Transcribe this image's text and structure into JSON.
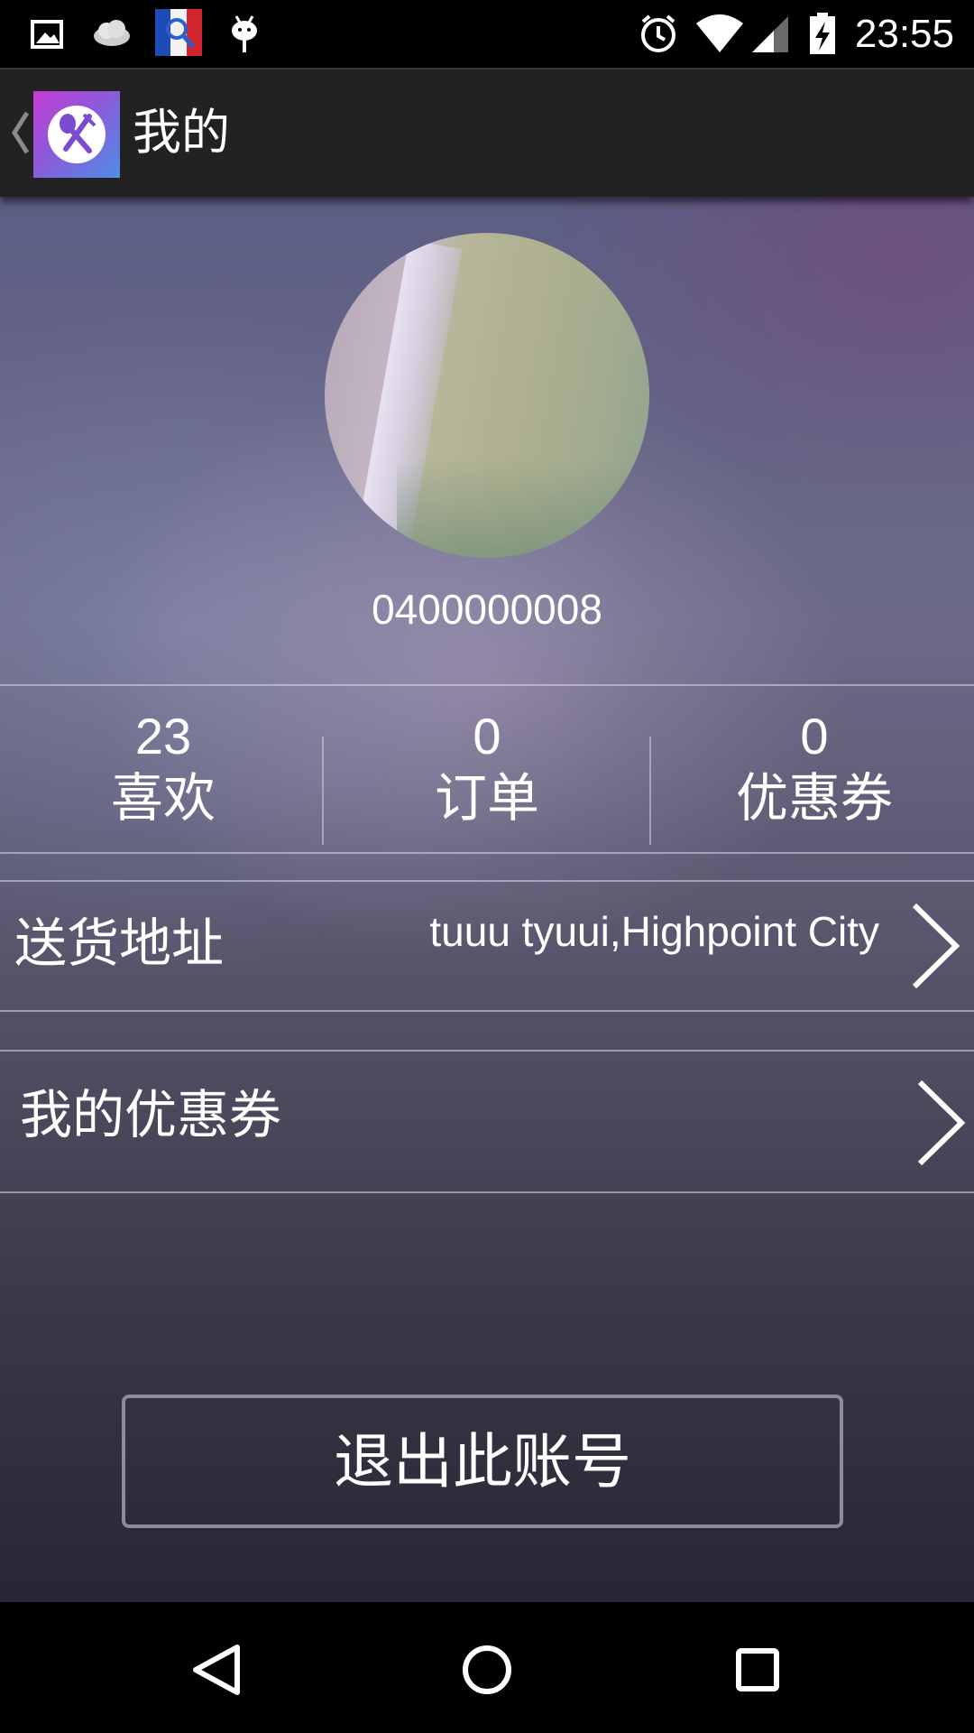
{
  "status_bar": {
    "time": "23:55",
    "left_icons": [
      "image-icon",
      "cloud-icon",
      "app-notification-icon",
      "android-debug-icon"
    ],
    "right_icons": [
      "alarm-icon",
      "wifi-icon",
      "cell-signal-icon",
      "battery-charging-icon"
    ]
  },
  "action_bar": {
    "title": "我的",
    "logo": "restaurant-app-logo"
  },
  "profile": {
    "username": "0400000008"
  },
  "stats": [
    {
      "value": "23",
      "label": "喜欢"
    },
    {
      "value": "0",
      "label": "订单"
    },
    {
      "value": "0",
      "label": "优惠券"
    }
  ],
  "rows": {
    "address": {
      "label": "送货地址",
      "value": "tuuu tyuui,Highpoint City"
    },
    "coupons": {
      "label": "我的优惠券"
    }
  },
  "logout_label": "退出此账号",
  "nav": [
    "back-icon",
    "home-icon",
    "recents-icon"
  ]
}
